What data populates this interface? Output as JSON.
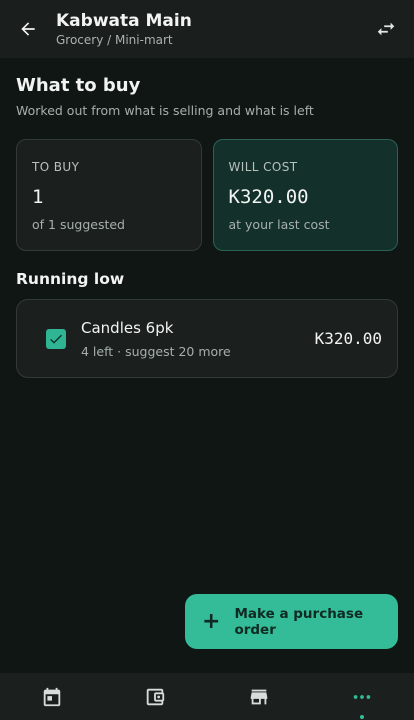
{
  "appbar": {
    "title": "Kabwata Main",
    "subtitle": "Grocery / Mini-mart"
  },
  "header": {
    "title": "What to buy",
    "subtitle": "Worked out from what is selling and what is left"
  },
  "summary": {
    "to_buy": {
      "label": "TO BUY",
      "value": "1",
      "note": "of 1 suggested"
    },
    "will_cost": {
      "label": "WILL COST",
      "value": "K320.00",
      "note": "at your last cost"
    }
  },
  "running_low": {
    "title": "Running low",
    "items": [
      {
        "name": "Candles 6pk",
        "meta": "4 left · suggest 20 more",
        "price": "K320.00",
        "checked": true
      }
    ]
  },
  "fab": {
    "plus": "+",
    "label": "Make a purchase order"
  },
  "nav": {
    "tabs": [
      {
        "icon": "calendar-icon"
      },
      {
        "icon": "wallet-icon"
      },
      {
        "icon": "store-icon"
      },
      {
        "icon": "more-icon",
        "active": true
      }
    ]
  },
  "colors": {
    "accent": "#34bc98",
    "background": "#101614",
    "surface": "#1b201e",
    "accent_card": "#13302a"
  }
}
